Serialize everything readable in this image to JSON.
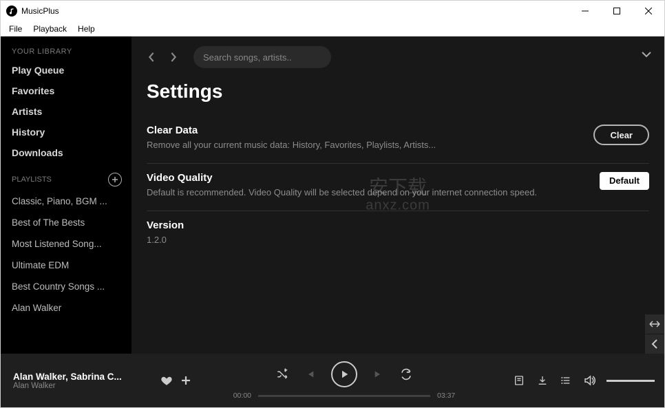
{
  "app": {
    "title": "MusicPlus"
  },
  "menu": [
    "File",
    "Playback",
    "Help"
  ],
  "sidebar": {
    "library_header": "YOUR LIBRARY",
    "library": [
      "Play Queue",
      "Favorites",
      "Artists",
      "History",
      "Downloads"
    ],
    "playlists_header": "PLAYLISTS",
    "playlists": [
      "Classic, Piano, BGM ...",
      "Best of The Bests",
      "Most Listened Song...",
      "Ultimate EDM",
      "Best Country Songs ...",
      "Alan Walker"
    ]
  },
  "search": {
    "placeholder": "Search songs, artists.."
  },
  "page": {
    "title": "Settings",
    "clear": {
      "label": "Clear Data",
      "desc": "Remove all your current music data: History, Favorites, Playlists, Artists...",
      "button": "Clear"
    },
    "video": {
      "label": "Video Quality",
      "desc": "Default is recommended. Video Quality will be selected depend on your internet connection speed.",
      "button": "Default"
    },
    "version": {
      "label": "Version",
      "value": "1.2.0"
    }
  },
  "player": {
    "track_title": "Alan Walker, Sabrina C...",
    "track_artist": "Alan Walker",
    "elapsed": "00:00",
    "total": "03:37"
  },
  "watermark": {
    "top": "安下载",
    "bottom": "anxz.com"
  }
}
